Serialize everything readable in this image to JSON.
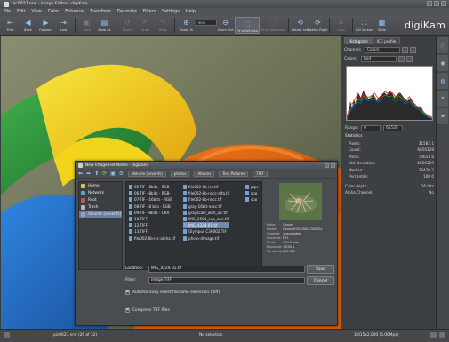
{
  "window": {
    "title": "pic0027.nrw - Image Editor - digiKam"
  },
  "menu": [
    "File",
    "Edit",
    "View",
    "Color",
    "Enhance",
    "Transform",
    "Decorate",
    "Filters",
    "Settings",
    "Help"
  ],
  "toolbar": {
    "buttons": [
      {
        "label": "First",
        "icon": "first-icon",
        "glyph": "⇤",
        "enabled": true
      },
      {
        "label": "Back",
        "icon": "back-icon",
        "glyph": "◀",
        "enabled": true
      },
      {
        "label": "Forward",
        "icon": "forward-icon",
        "glyph": "▶",
        "enabled": true
      },
      {
        "label": "Last",
        "icon": "last-icon",
        "glyph": "⇥",
        "enabled": true
      },
      {
        "label": "Save",
        "icon": "save-icon",
        "glyph": "▣",
        "enabled": false
      },
      {
        "label": "Save As",
        "icon": "save-as-icon",
        "glyph": "▤",
        "enabled": true
      },
      {
        "label": "Revert",
        "icon": "revert-icon",
        "glyph": "↺",
        "enabled": false
      },
      {
        "label": "Undo",
        "icon": "undo-icon",
        "glyph": "↶",
        "enabled": false
      },
      {
        "label": "Redo",
        "icon": "redo-icon",
        "glyph": "↷",
        "enabled": false
      },
      {
        "label": "Zoom In",
        "icon": "zoom-in-icon",
        "glyph": "⊕",
        "enabled": true
      },
      {
        "label": "Zoom Out",
        "icon": "zoom-out-icon",
        "glyph": "⊖",
        "enabled": true
      },
      {
        "label": "Fit to Window",
        "icon": "fit-window-icon",
        "glyph": "⬚",
        "enabled": true
      },
      {
        "label": "Fit to Selection",
        "icon": "fit-selection-icon",
        "glyph": "⬚",
        "enabled": false
      },
      {
        "label": "Rotate Left",
        "icon": "rotate-left-icon",
        "glyph": "⟲",
        "enabled": true
      },
      {
        "label": "Rotate Right",
        "icon": "rotate-right-icon",
        "glyph": "⟳",
        "enabled": true
      },
      {
        "label": "Crop",
        "icon": "crop-icon",
        "glyph": "⌗",
        "enabled": false
      },
      {
        "label": "Full Screen",
        "icon": "full-screen-icon",
        "glyph": "⛶",
        "enabled": true
      },
      {
        "label": "Slide",
        "icon": "slide-icon",
        "glyph": "▦",
        "enabled": true
      }
    ],
    "zoom_value": "50%"
  },
  "logo": "digiKam",
  "right_panel": {
    "tabs": [
      "Histogram",
      "ICC profile"
    ],
    "channel_label": "Channel:",
    "channel_value": "Colors",
    "colors_label": "Colors:",
    "colors_value": "Red",
    "range_label": "Range:",
    "range_min": "0",
    "range_max": "65535",
    "statistics_label": "Statistics",
    "stats": [
      {
        "k": "Pixels:",
        "v": "31582.1"
      },
      {
        "k": "Count:",
        "v": "6656129"
      },
      {
        "k": "Mean:",
        "v": "70653.6"
      },
      {
        "k": "Std. deviation:",
        "v": "6656129"
      },
      {
        "k": "Median:",
        "v": "33470.2"
      },
      {
        "k": "Percentile:",
        "v": "100.0"
      }
    ],
    "stats2": [
      {
        "k": "Color depth:",
        "v": "16 bits"
      },
      {
        "k": "Alpha Channel:",
        "v": "No"
      }
    ]
  },
  "side_tabs": [
    "Properties",
    "Metadata",
    "Colors",
    "Geolocation",
    "Tags"
  ],
  "dialog": {
    "title": "New Image File Name - digiKam",
    "breadcrumb": [
      "Volume (sevenfs)",
      "photos",
      "Albums",
      "Test Pictures",
      "TIFF"
    ],
    "places": [
      {
        "label": "Home",
        "color": "#d9c35a"
      },
      {
        "label": "Network",
        "color": "#5fa0d8"
      },
      {
        "label": "Root",
        "color": "#c9534a"
      },
      {
        "label": "Trash",
        "color": "#b8b8b8"
      },
      {
        "label": "Volume (sevenfs)",
        "color": "#9aa0a8"
      }
    ],
    "files_col1": [
      "05-TIF - 8bits - RGB-",
      "06-TIF - 8bits - RGB-",
      "07-TIF - 16bits - RGB",
      "08-TIF - 8 bits - RGB",
      "09-TIF - 8bits - GRA",
      "10.TIFF",
      "12.TIFF",
      "13.TIFF",
      "file002-8b-icc-alpha.tif"
    ],
    "files_col2": [
      "file002-8b-icc.tif",
      "file002-8b-nocc-alfa.tif",
      "file002-8b-nocc.tif",
      "gray-16bit-nocc.tif",
      "grayscale_with_icc.tif",
      "IMG_2504_cup_one.tif",
      "IMG_4224-01.tif",
      "Olympus C3000Z.TIF",
      "photo-dimage.tif"
    ],
    "files_col3": [
      "pipe",
      "spo",
      "spo"
    ],
    "selected_file": "IMG_4224-01.tif",
    "meta": [
      {
        "k": "Make:",
        "v": "Canon"
      },
      {
        "k": "Model:",
        "v": "Canon EOS 300D DIGITAL"
      },
      {
        "k": "Created:",
        "v": "unavailable"
      },
      {
        "k": "Aperture:",
        "v": "F22"
      },
      {
        "k": "Focal:",
        "v": "100.0 mm"
      },
      {
        "k": "Exposure:",
        "v": "1/200 s"
      },
      {
        "k": "Sensitivity:",
        "v": "100 ISO"
      }
    ],
    "location_label": "Location:",
    "location_value": "IMG_4224-01.tif",
    "filter_label": "Filter:",
    "filter_value": "image TIFF",
    "save_label": "Save",
    "cancel_label": "Cancel",
    "auto_ext_label": "Automatically select filename extension (.tiff)",
    "compress_label": "Compress TIFF files"
  },
  "statusbar": {
    "file_info": "pic0027.nrw (29 of 32)",
    "selection": "No selection",
    "dims": "3,015x2,000 (6.00Mpx)"
  }
}
